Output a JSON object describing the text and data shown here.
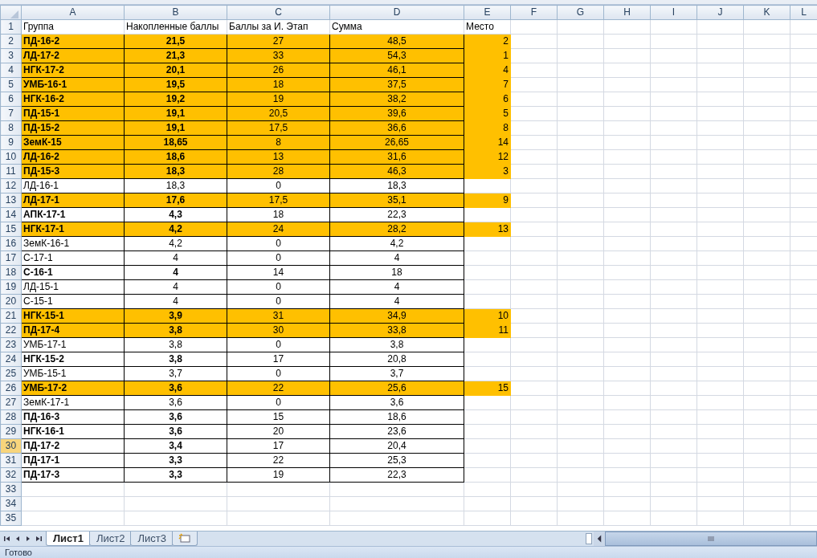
{
  "columns": [
    "A",
    "B",
    "C",
    "D",
    "E",
    "F",
    "G",
    "H",
    "I",
    "J",
    "K",
    "L"
  ],
  "header_row": {
    "number": "1",
    "cells": [
      "Группа",
      "Накопленные баллы",
      "Баллы за И. Этап",
      "Сумма",
      "Место"
    ]
  },
  "rows": [
    {
      "number": "2",
      "group": "ПД-16-2",
      "accumulated": "21,5",
      "stage": "27",
      "sum": "48,5",
      "place": "2",
      "highlighted": true,
      "bold": true,
      "selected": false
    },
    {
      "number": "3",
      "group": "ЛД-17-2",
      "accumulated": "21,3",
      "stage": "33",
      "sum": "54,3",
      "place": "1",
      "highlighted": true,
      "bold": true,
      "selected": false
    },
    {
      "number": "4",
      "group": "НГК-17-2",
      "accumulated": "20,1",
      "stage": "26",
      "sum": "46,1",
      "place": "4",
      "highlighted": true,
      "bold": true,
      "selected": false
    },
    {
      "number": "5",
      "group": "УМБ-16-1",
      "accumulated": "19,5",
      "stage": "18",
      "sum": "37,5",
      "place": "7",
      "highlighted": true,
      "bold": true,
      "selected": false
    },
    {
      "number": "6",
      "group": "НГК-16-2",
      "accumulated": "19,2",
      "stage": "19",
      "sum": "38,2",
      "place": "6",
      "highlighted": true,
      "bold": true,
      "selected": false
    },
    {
      "number": "7",
      "group": "ПД-15-1",
      "accumulated": "19,1",
      "stage": "20,5",
      "sum": "39,6",
      "place": "5",
      "highlighted": true,
      "bold": true,
      "selected": false
    },
    {
      "number": "8",
      "group": "ПД-15-2",
      "accumulated": "19,1",
      "stage": "17,5",
      "sum": "36,6",
      "place": "8",
      "highlighted": true,
      "bold": true,
      "selected": false
    },
    {
      "number": "9",
      "group": "ЗемК-15",
      "accumulated": "18,65",
      "stage": "8",
      "sum": "26,65",
      "place": "14",
      "highlighted": true,
      "bold": true,
      "selected": false
    },
    {
      "number": "10",
      "group": "ЛД-16-2",
      "accumulated": "18,6",
      "stage": "13",
      "sum": "31,6",
      "place": "12",
      "highlighted": true,
      "bold": true,
      "selected": false
    },
    {
      "number": "11",
      "group": "ПД-15-3",
      "accumulated": "18,3",
      "stage": "28",
      "sum": "46,3",
      "place": "3",
      "highlighted": true,
      "bold": true,
      "selected": false
    },
    {
      "number": "12",
      "group": "ЛД-16-1",
      "accumulated": "18,3",
      "stage": "0",
      "sum": "18,3",
      "highlighted": false,
      "bold": false,
      "selected": false
    },
    {
      "number": "13",
      "group": "ЛД-17-1",
      "accumulated": "17,6",
      "stage": "17,5",
      "sum": "35,1",
      "place": "9",
      "highlighted": true,
      "bold": true,
      "selected": false
    },
    {
      "number": "14",
      "group": "АПК-17-1",
      "accumulated": "4,3",
      "stage": "18",
      "sum": "22,3",
      "highlighted": false,
      "bold": true,
      "selected": false
    },
    {
      "number": "15",
      "group": "НГК-17-1",
      "accumulated": "4,2",
      "stage": "24",
      "sum": "28,2",
      "place": "13",
      "highlighted": true,
      "bold": true,
      "selected": false
    },
    {
      "number": "16",
      "group": "ЗемК-16-1",
      "accumulated": "4,2",
      "stage": "0",
      "sum": "4,2",
      "highlighted": false,
      "bold": false,
      "selected": false
    },
    {
      "number": "17",
      "group": "С-17-1",
      "accumulated": "4",
      "stage": "0",
      "sum": "4",
      "highlighted": false,
      "bold": false,
      "selected": false
    },
    {
      "number": "18",
      "group": "С-16-1",
      "accumulated": "4",
      "stage": "14",
      "sum": "18",
      "highlighted": false,
      "bold": true,
      "selected": false
    },
    {
      "number": "19",
      "group": "ЛД-15-1",
      "accumulated": "4",
      "stage": "0",
      "sum": "4",
      "highlighted": false,
      "bold": false,
      "selected": false
    },
    {
      "number": "20",
      "group": "С-15-1",
      "accumulated": "4",
      "stage": "0",
      "sum": "4",
      "highlighted": false,
      "bold": false,
      "selected": false
    },
    {
      "number": "21",
      "group": "НГК-15-1",
      "accumulated": "3,9",
      "stage": "31",
      "sum": "34,9",
      "place": "10",
      "highlighted": true,
      "bold": true,
      "selected": false
    },
    {
      "number": "22",
      "group": "ПД-17-4",
      "accumulated": "3,8",
      "stage": "30",
      "sum": "33,8",
      "place": "11",
      "highlighted": true,
      "bold": true,
      "selected": false
    },
    {
      "number": "23",
      "group": "УМБ-17-1",
      "accumulated": "3,8",
      "stage": "0",
      "sum": "3,8",
      "highlighted": false,
      "bold": false,
      "selected": false
    },
    {
      "number": "24",
      "group": "НГК-15-2",
      "accumulated": "3,8",
      "stage": "17",
      "sum": "20,8",
      "highlighted": false,
      "bold": true,
      "selected": false
    },
    {
      "number": "25",
      "group": "УМБ-15-1",
      "accumulated": "3,7",
      "stage": "0",
      "sum": "3,7",
      "highlighted": false,
      "bold": false,
      "selected": false
    },
    {
      "number": "26",
      "group": "УМБ-17-2",
      "accumulated": "3,6",
      "stage": "22",
      "sum": "25,6",
      "place": "15",
      "highlighted": true,
      "bold": true,
      "selected": false
    },
    {
      "number": "27",
      "group": "ЗемК-17-1",
      "accumulated": "3,6",
      "stage": "0",
      "sum": "3,6",
      "highlighted": false,
      "bold": false,
      "selected": false
    },
    {
      "number": "28",
      "group": "ПД-16-3",
      "accumulated": "3,6",
      "stage": "15",
      "sum": "18,6",
      "highlighted": false,
      "bold": true,
      "selected": false
    },
    {
      "number": "29",
      "group": "НГК-16-1",
      "accumulated": "3,6",
      "stage": "20",
      "sum": "23,6",
      "highlighted": false,
      "bold": true,
      "selected": false
    },
    {
      "number": "30",
      "group": "ПД-17-2",
      "accumulated": "3,4",
      "stage": "17",
      "sum": "20,4",
      "highlighted": false,
      "bold": true,
      "selected": true
    },
    {
      "number": "31",
      "group": "ПД-17-1",
      "accumulated": "3,3",
      "stage": "22",
      "sum": "25,3",
      "highlighted": false,
      "bold": true,
      "selected": false
    },
    {
      "number": "32",
      "group": "ПД-17-3",
      "accumulated": "3,3",
      "stage": "19",
      "sum": "22,3",
      "highlighted": false,
      "bold": true,
      "selected": false
    }
  ],
  "empty_rows": [
    "33",
    "34",
    "35"
  ],
  "sheet_tabs": [
    {
      "label": "Лист1",
      "selected": true
    },
    {
      "label": "Лист2",
      "selected": false
    },
    {
      "label": "Лист3",
      "selected": false
    }
  ],
  "status_bar": {
    "text": "Готово"
  }
}
